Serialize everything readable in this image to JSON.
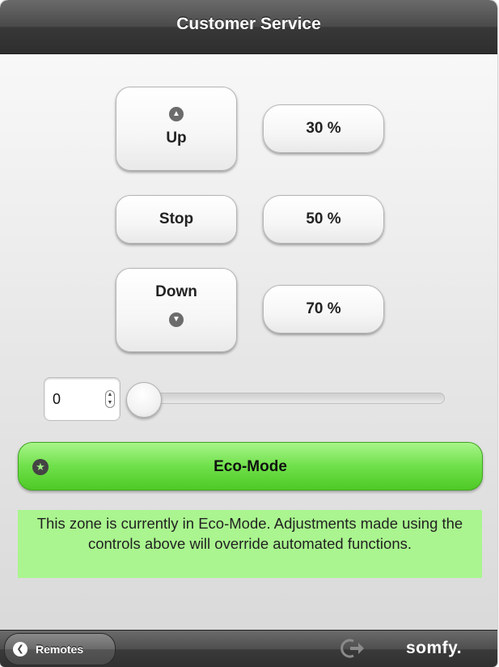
{
  "header": {
    "title": "Customer Service"
  },
  "controls": {
    "up_label": "Up",
    "stop_label": "Stop",
    "down_label": "Down",
    "preset_30": "30 %",
    "preset_50": "50 %",
    "preset_70": "70 %"
  },
  "position": {
    "stepper_value": "0",
    "slider_value": 0
  },
  "eco": {
    "button_label": "Eco-Mode",
    "note": "This zone is currently in Eco-Mode. Adjustments made using the controls above will override automated functions."
  },
  "footer": {
    "back_label": "Remotes",
    "brand": "somfy."
  },
  "icons": {
    "up": "chevron-up-icon",
    "down": "chevron-down-icon",
    "eco": "star-icon",
    "back": "chevron-left-icon",
    "logout": "logout-icon"
  },
  "colors": {
    "eco_green": "#6fe04a",
    "eco_note_bg": "#aaf58f",
    "bar_dark": "#3a3a3a"
  }
}
